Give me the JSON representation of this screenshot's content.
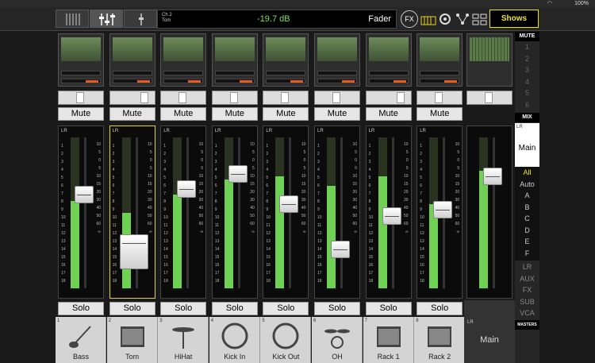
{
  "status": {
    "battery": "100%"
  },
  "topbar": {
    "channel_number": "Ch 2",
    "channel_name": "Tom",
    "level": "-19.7 dB",
    "mode": "Fader",
    "fx_label": "FX",
    "shows_label": "Shows"
  },
  "strip_labels": {
    "mute": "Mute",
    "solo": "Solo",
    "lr": "LR"
  },
  "left_scale": [
    "1",
    "2",
    "3",
    "4",
    "5",
    "6",
    "7",
    "8",
    "9",
    "10",
    "11",
    "12",
    "13",
    "14",
    "15",
    "16",
    "17",
    "18"
  ],
  "right_scale": [
    "10",
    "5",
    "0",
    "5",
    "10",
    "15",
    "20",
    "30",
    "40",
    "50",
    "60",
    "∞"
  ],
  "channels": [
    {
      "num": "1",
      "name": "Bass",
      "icon": "bass-guitar-icon",
      "fader": 0.62,
      "meter": 0.58
    },
    {
      "num": "2",
      "name": "Tom",
      "icon": "tom-drum-icon",
      "fader": 0.24,
      "meter": 0.5,
      "selected": true
    },
    {
      "num": "3",
      "name": "HiHat",
      "icon": "hihat-icon",
      "fader": 0.66,
      "meter": 0.62
    },
    {
      "num": "4",
      "name": "Kick In",
      "icon": "kick-drum-icon",
      "fader": 0.76,
      "meter": 0.72
    },
    {
      "num": "5",
      "name": "Kick Out",
      "icon": "kick-drum-icon",
      "fader": 0.56,
      "meter": 0.74
    },
    {
      "num": "6",
      "name": "OH",
      "icon": "cymbals-icon",
      "fader": 0.26,
      "meter": 0.68
    },
    {
      "num": "7",
      "name": "Rack 1",
      "icon": "rack-tom-icon",
      "fader": 0.48,
      "meter": 0.74
    },
    {
      "num": "8",
      "name": "Rack 2",
      "icon": "rack-tom-icon",
      "fader": 0.52,
      "meter": 0.56
    }
  ],
  "main": {
    "lr": "LR",
    "name": "Main",
    "fader": 0.74,
    "meter": 0.78
  },
  "side": {
    "mute_header": "MUTE",
    "mute_groups": [
      "1",
      "2",
      "3",
      "4",
      "5",
      "6"
    ],
    "mix_header": "MIX",
    "mix_lr": "LR",
    "mix_name": "Main",
    "filters": [
      "All",
      "Auto",
      "A",
      "B",
      "C",
      "D",
      "E",
      "F"
    ],
    "buses": [
      "LR",
      "AUX",
      "FX",
      "SUB",
      "VCA"
    ],
    "masters": "MASTERS"
  },
  "colors": {
    "accent": "#f1e41a",
    "meter": "#6ed154",
    "level_text": "#7fe05a",
    "pan_red": "#e85a1c"
  }
}
